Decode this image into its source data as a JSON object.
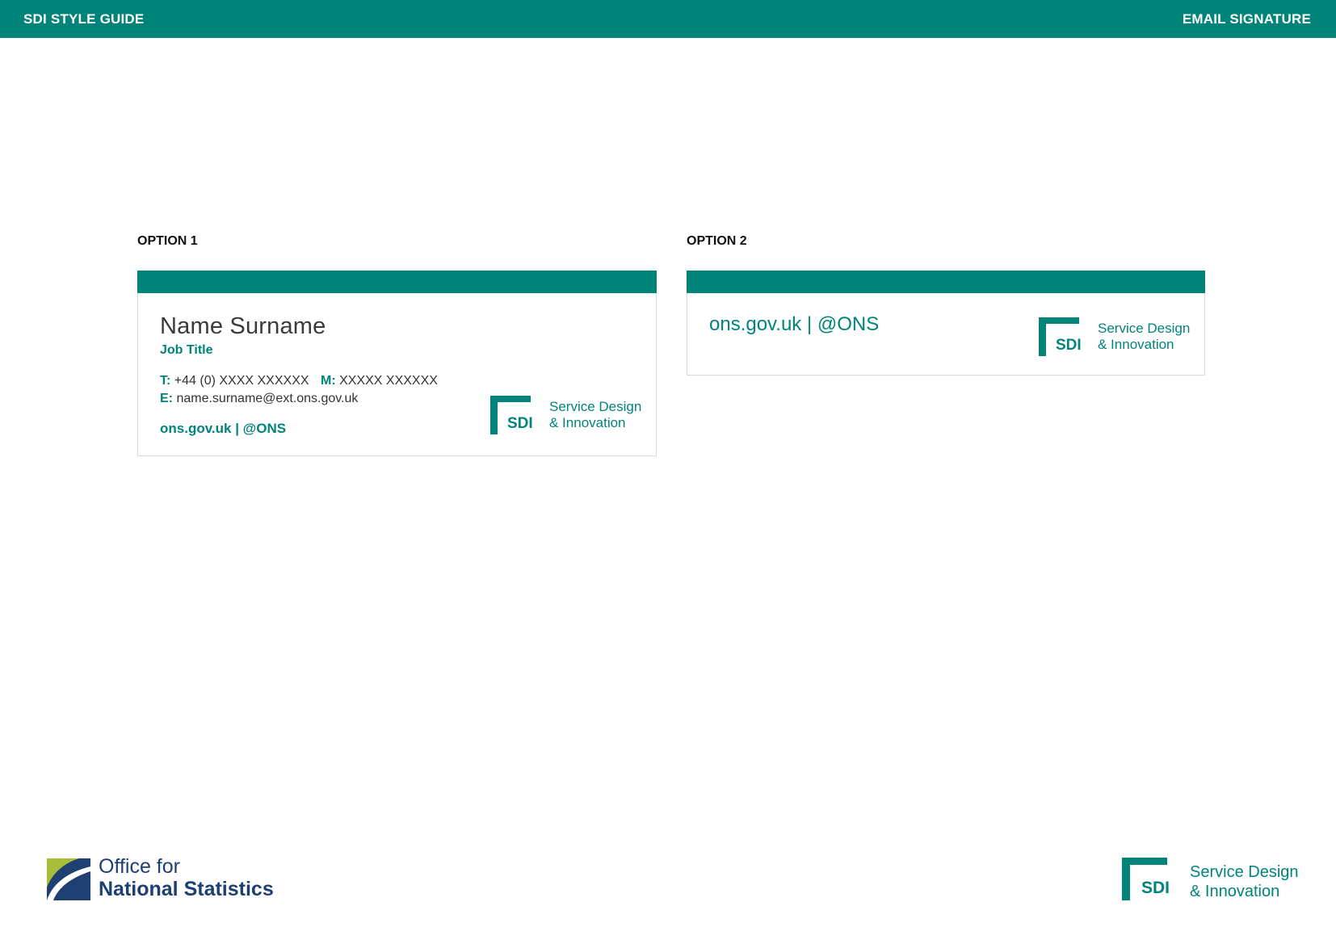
{
  "header": {
    "left_title": "SDI STYLE GUIDE",
    "right_title": "EMAIL SIGNATURE"
  },
  "colors": {
    "brand": "#00847a",
    "ons_navy": "#1d3f72",
    "ons_lime": "#a8bd3a"
  },
  "option1": {
    "label": "OPTION 1",
    "name": "Name Surname",
    "job_title": "Job Title",
    "phone_key": "T:",
    "phone_value": "+44 (0) XXXX XXXXXX",
    "mobile_key": "M:",
    "mobile_value": "XXXXX XXXXXX",
    "email_key": "E:",
    "email_value": "name.surname@ext.ons.gov.uk",
    "web": "ons.gov.uk | @ONS",
    "logo": {
      "mark": "SDI",
      "line1": "Service Design",
      "line2": "& Innovation"
    }
  },
  "option2": {
    "label": "OPTION 2",
    "web": "ons.gov.uk | @ONS",
    "logo": {
      "mark": "SDI",
      "line1": "Service Design",
      "line2": "& Innovation"
    }
  },
  "footer": {
    "ons_logo": {
      "line1": "Office for",
      "line2": "National Statistics"
    },
    "sdi_logo": {
      "mark": "SDI",
      "line1": "Service Design",
      "line2": "& Innovation"
    }
  }
}
